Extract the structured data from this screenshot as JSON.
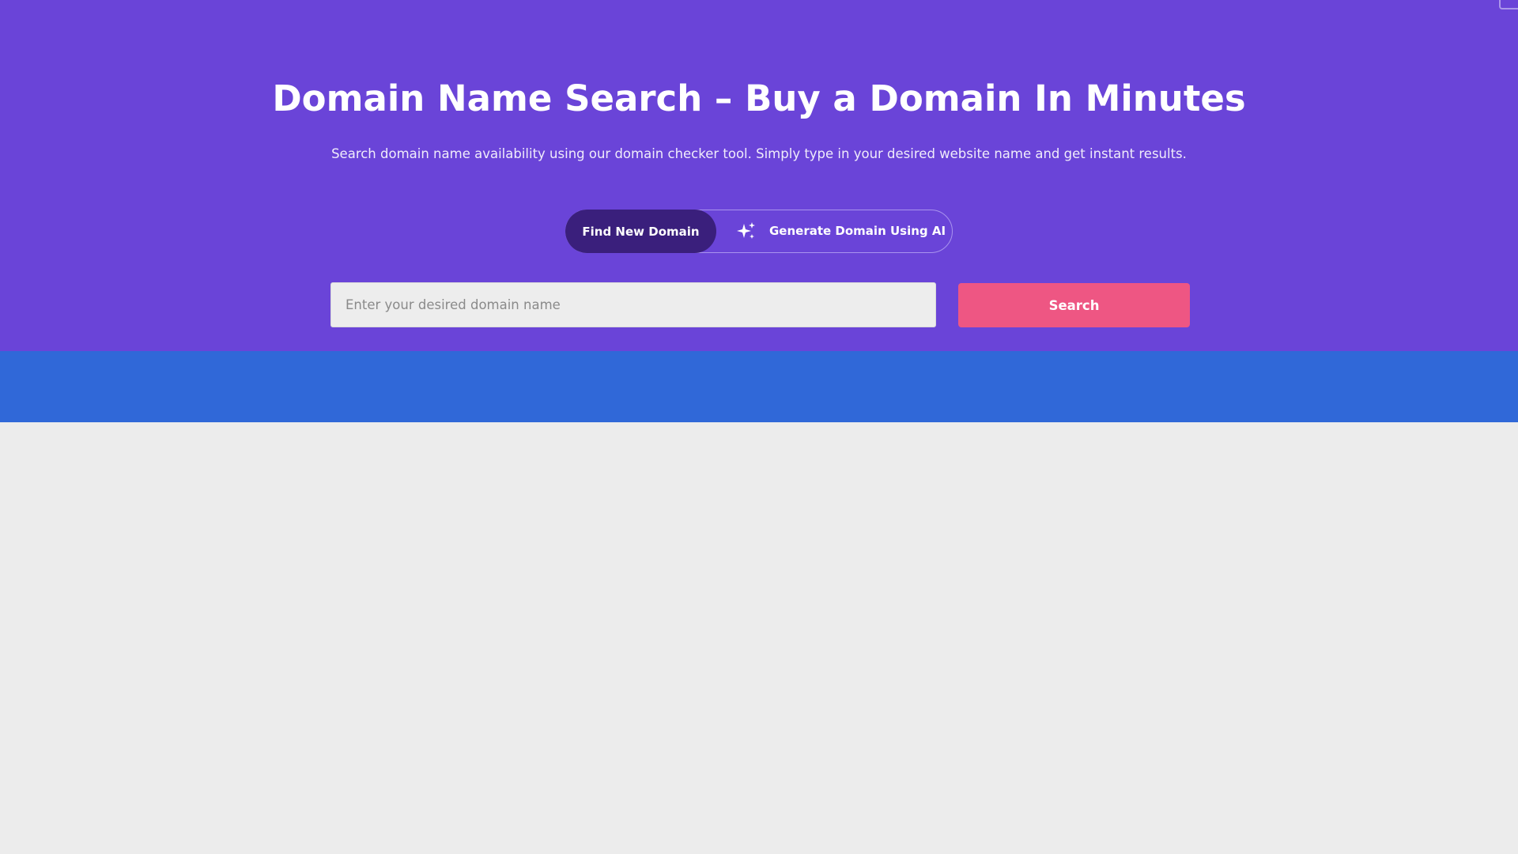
{
  "hero": {
    "title": "Domain Name Search – Buy a Domain In Minutes",
    "subtitle": "Search domain name availability using our domain checker tool. Simply type in your desired website name and get instant results."
  },
  "toggle": {
    "find_label": "Find New Domain",
    "ai_label": "Generate Domain Using AI",
    "ai_icon": "sparkle-icon",
    "active": "find"
  },
  "search": {
    "value": "",
    "placeholder": "Enter your desired domain name",
    "button_label": "Search"
  },
  "colors": {
    "hero_bg": "#6a44d8",
    "toggle_active_bg": "#3a1f7c",
    "search_button_bg": "#ee5683",
    "band_bg": "#3068d8",
    "page_bg": "#ececec"
  }
}
